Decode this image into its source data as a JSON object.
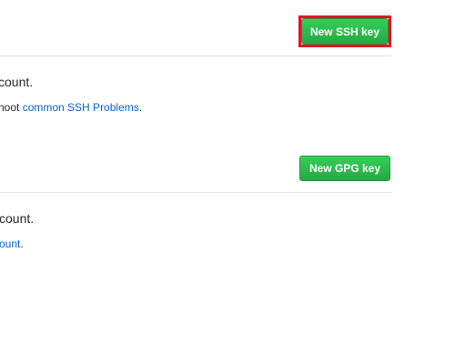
{
  "ssh": {
    "button": "New SSH key",
    "line1": "count.",
    "line2_prefix": "hoot ",
    "line2_link": "common SSH Problems",
    "line2_suffix": "."
  },
  "gpg": {
    "button": "New GPG key",
    "line1": "count.",
    "line2_link": "ount",
    "line2_suffix": "."
  },
  "colors": {
    "button": "#28a745",
    "highlight": "#e8102a",
    "link": "#0366d6"
  }
}
